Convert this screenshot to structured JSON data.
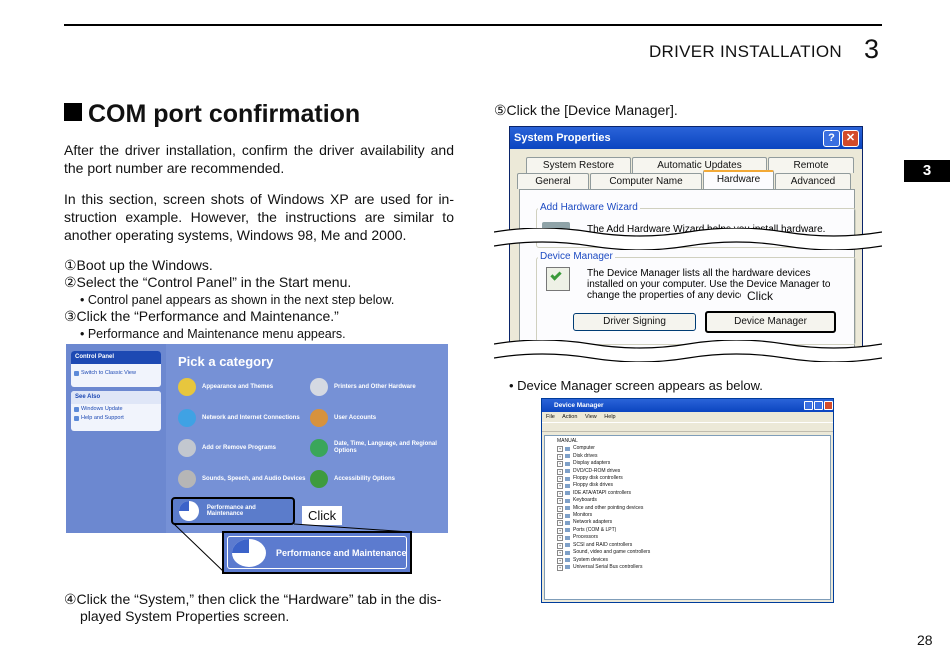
{
  "header": {
    "chapter_title": "DRIVER INSTALLATION",
    "chapter_number": "3",
    "side_tab": "3",
    "page_number": "28"
  },
  "section": {
    "title": "COM port confirmation",
    "intro": "After the driver installation, confirm the driver availability and the port number are recommended.",
    "note": "In this section, screen shots of Windows XP are used for in-struction example. However, the instructions are similar to another operating systems, Windows 98, Me and 2000."
  },
  "steps": {
    "s1": "①Boot up the Windows.",
    "s2": "②Select the “Control Panel” in the Start menu.",
    "s2_bullet": "• Control panel appears as shown in the next step below.",
    "s3": "③Click the “Performance and Maintenance.”",
    "s3_bullet": "• Performance and Maintenance menu appears.",
    "s4_line1": "④Click the “System,” then click the “Hardware” tab in the dis-",
    "s4_line2": "played System Properties screen.",
    "s5": "⑤Click the [Device Manager].",
    "s5_bullet": "• Device Manager screen appears as below."
  },
  "control_panel": {
    "panel_title": "Control Panel",
    "switch_link": "Switch to Classic View",
    "see_also": "See Also",
    "see_also_links": [
      "Windows Update",
      "Help and Support"
    ],
    "pick_category": "Pick a category",
    "categories": [
      "Appearance and Themes",
      "Printers and Other Hardware",
      "Network and Internet Connections",
      "User Accounts",
      "Add or Remove Programs",
      "Date, Time, Language, and Regional Options",
      "Sounds, Speech, and Audio Devices",
      "Accessibility Options",
      "Performance and Maintenance"
    ],
    "click_label": "Click",
    "zoom_label": "Performance and Maintenance"
  },
  "system_properties": {
    "title": "System Properties",
    "help_btn": "?",
    "close_btn": "✕",
    "tabs_row1": [
      "System Restore",
      "Automatic Updates",
      "Remote"
    ],
    "tabs_row2": [
      "General",
      "Computer Name",
      "Hardware",
      "Advanced"
    ],
    "add_hw_group": "Add Hardware Wizard",
    "add_hw_text": "The Add Hardware Wizard helps you install hardware.",
    "dm_group": "Device Manager",
    "dm_text": "The Device Manager lists all the hardware devices installed on your computer. Use the Device Manager to change the properties of any device.",
    "btn_driver_signing": "Driver Signing",
    "btn_device_manager": "Device Manager",
    "click_label": "Click"
  },
  "device_manager": {
    "title": "Device Manager",
    "menu": [
      "File",
      "Action",
      "View",
      "Help"
    ],
    "root": "MANUAL",
    "items": [
      "Computer",
      "Disk drives",
      "Display adapters",
      "DVD/CD-ROM drives",
      "Floppy disk controllers",
      "Floppy disk drives",
      "IDE ATA/ATAPI controllers",
      "Keyboards",
      "Mice and other pointing devices",
      "Monitors",
      "Network adapters",
      "Ports (COM & LPT)",
      "Processors",
      "SCSI and RAID controllers",
      "Sound, video and game controllers",
      "System devices",
      "Universal Serial Bus controllers"
    ]
  }
}
